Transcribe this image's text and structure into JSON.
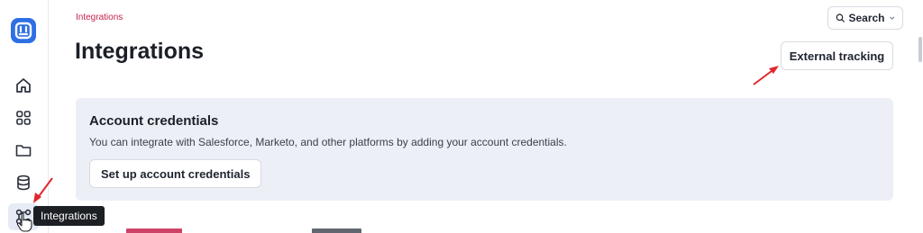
{
  "breadcrumb": "Integrations",
  "page_title": "Integrations",
  "search": {
    "label": "Search",
    "icon": "search-icon"
  },
  "external_tracking_label": "External tracking",
  "credentials_card": {
    "title": "Account credentials",
    "description": "You can integrate with Salesforce, Marketo, and other platforms by adding your account credentials.",
    "button_label": "Set up account credentials"
  },
  "sidebar": {
    "items": [
      {
        "name": "home",
        "icon": "home-icon"
      },
      {
        "name": "apps",
        "icon": "grid-icon"
      },
      {
        "name": "files",
        "icon": "folder-icon"
      },
      {
        "name": "data",
        "icon": "database-icon"
      },
      {
        "name": "integrations",
        "icon": "integrations-icon",
        "active": true
      }
    ],
    "tooltip": "Integrations"
  },
  "colors": {
    "accent": "#c4224d",
    "brand": "#2f6fe4",
    "card_bg": "#eceff5",
    "annotation": "#e0282e"
  }
}
